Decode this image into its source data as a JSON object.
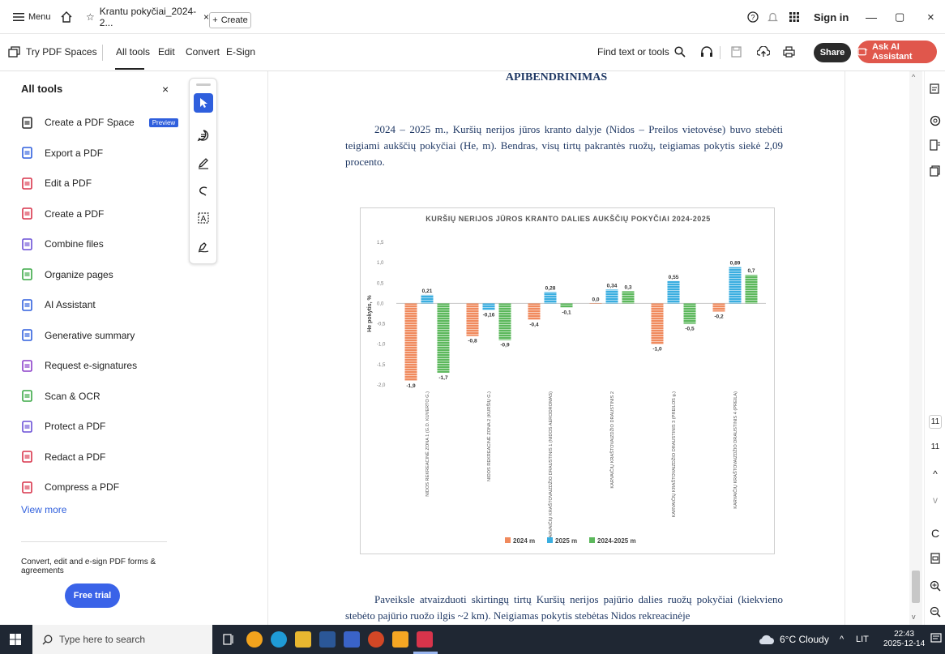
{
  "titlebar": {
    "menu_label": "Menu",
    "tab_title": "Krantu pokyčiai_2024-2...",
    "tab_close": "×",
    "new_tab_label": "Create",
    "sign_in": "Sign in",
    "minimize": "—",
    "restore": "▢",
    "close": "×"
  },
  "toolbar": {
    "try_spaces": "Try PDF Spaces",
    "nav": [
      "All tools",
      "Edit",
      "Convert",
      "E-Sign"
    ],
    "find_text": "Find text or tools",
    "share": "Share",
    "ask_ai": "Ask AI Assistant"
  },
  "left_panel": {
    "title": "All tools",
    "close": "×",
    "tools": [
      {
        "label": "Create a PDF Space",
        "icon": "spaces-icon",
        "color": "#2b2b2b"
      },
      {
        "label": "Export a PDF",
        "icon": "export-icon",
        "color": "#2f5fdd"
      },
      {
        "label": "Edit a PDF",
        "icon": "edit-pdf-icon",
        "color": "#d8344b"
      },
      {
        "label": "Create a PDF",
        "icon": "create-pdf-icon",
        "color": "#d8344b"
      },
      {
        "label": "Combine files",
        "icon": "combine-icon",
        "color": "#6a4fd6"
      },
      {
        "label": "Organize pages",
        "icon": "organize-icon",
        "color": "#3aa845"
      },
      {
        "label": "AI Assistant",
        "icon": "ai-assistant-icon",
        "color": "#2f5fdd"
      },
      {
        "label": "Generative summary",
        "icon": "summary-icon",
        "color": "#2f5fdd"
      },
      {
        "label": "Request e-signatures",
        "icon": "esign-icon",
        "color": "#8b3fc9"
      },
      {
        "label": "Scan & OCR",
        "icon": "scan-icon",
        "color": "#3aa845"
      },
      {
        "label": "Protect a PDF",
        "icon": "protect-icon",
        "color": "#6a4fd6"
      },
      {
        "label": "Redact a PDF",
        "icon": "redact-icon",
        "color": "#d8344b"
      },
      {
        "label": "Compress a PDF",
        "icon": "compress-icon",
        "color": "#d8344b"
      }
    ],
    "preview_badge": "Preview",
    "view_more": "View more",
    "promo": "Convert, edit and e-sign PDF forms & agreements",
    "free_trial": "Free trial"
  },
  "document": {
    "heading": "APIBENDRINIMAS",
    "para1": "2024 – 2025 m., Kuršių nerijos jūros kranto dalyje (Nidos – Preilos vietovėse) buvo stebėti teigiami aukščių pokyčiai (He, m). Bendras, visų tirtų pakrantės ruožų, teigiamas pokytis siekė 2,09 procento.",
    "para2": "Paveiksle atvaizduoti skirtingų tirtų Kuršių nerijos pajūrio dalies ruožų pokyčiai (kiekvieno stebėto pajūrio ruožo ilgis ~2 km). Neigiamas pokytis stebėtas Nidos rekreacinėje"
  },
  "chart_data": {
    "type": "bar",
    "title": "KURŠIŲ NERIJOS JŪROS KRANTO DALIES AUKŠČIŲ POKYČIAI 2024-2025",
    "ylabel": "He pokytis, %",
    "xlabel": "",
    "ylim": [
      -2.0,
      1.5
    ],
    "yticks": [
      "1,5",
      "1,0",
      "0,5",
      "0,0",
      "-0,5",
      "-1,0",
      "-1,5",
      "-2,0"
    ],
    "ytick_values": [
      1.5,
      1.0,
      0.5,
      0.0,
      -0.5,
      -1.0,
      -1.5,
      -2.0
    ],
    "categories": [
      "NIDOS REKREACINĖ ZONA 1 (G.D. KUVERTO G.)",
      "NIDOS REKREACINĖ ZONA 2 (KURŠIŲ G.)",
      "KARVAIČIŲ KRAŠTOVAIZDŽIO DRAUSTINIS 1 (NIDOS AERODROMAS)",
      "KARVAIČIŲ KRAŠTOVAIZDŽIO DRAUSTINIS 2",
      "KARVAIČIŲ KRAŠTOVAIZDŽIO DRAUSTINIS 3 (PREILOS g.)",
      "KARVAIČIŲ KRAŠTOVAIZDŽIO DRAUSTINIS 4 (PREILA)"
    ],
    "series": [
      {
        "name": "2024 m",
        "color": "#f08a5d",
        "values": [
          -1.9,
          -0.8,
          -0.4,
          0.0,
          -1.0,
          -0.2
        ],
        "labels": [
          "-1,9",
          "-0,8",
          "-0,4",
          "0,0",
          "-1,0",
          "-0,2"
        ]
      },
      {
        "name": "2025 m",
        "color": "#3aaee0",
        "values": [
          0.21,
          -0.16,
          0.28,
          0.34,
          0.55,
          0.89
        ],
        "labels": [
          "0,21",
          "-0,16",
          "0,28",
          "0,34",
          "0,55",
          "0,89"
        ]
      },
      {
        "name": "2024-2025 m",
        "color": "#5cb85c",
        "values": [
          -1.7,
          -0.9,
          -0.1,
          0.3,
          -0.5,
          0.7
        ],
        "labels": [
          "-1,7",
          "-0,9",
          "-0,1",
          "0,3",
          "-0,5",
          "0,7"
        ]
      }
    ],
    "grid": false,
    "legend": "bottom"
  },
  "right_rail": {
    "page_num_a": "11",
    "page_num_b": "11"
  },
  "taskbar": {
    "search_placeholder": "Type here to search",
    "weather": "6°C Cloudy",
    "lang": "LIT",
    "time": "22:43",
    "date": "2025-12-14"
  }
}
